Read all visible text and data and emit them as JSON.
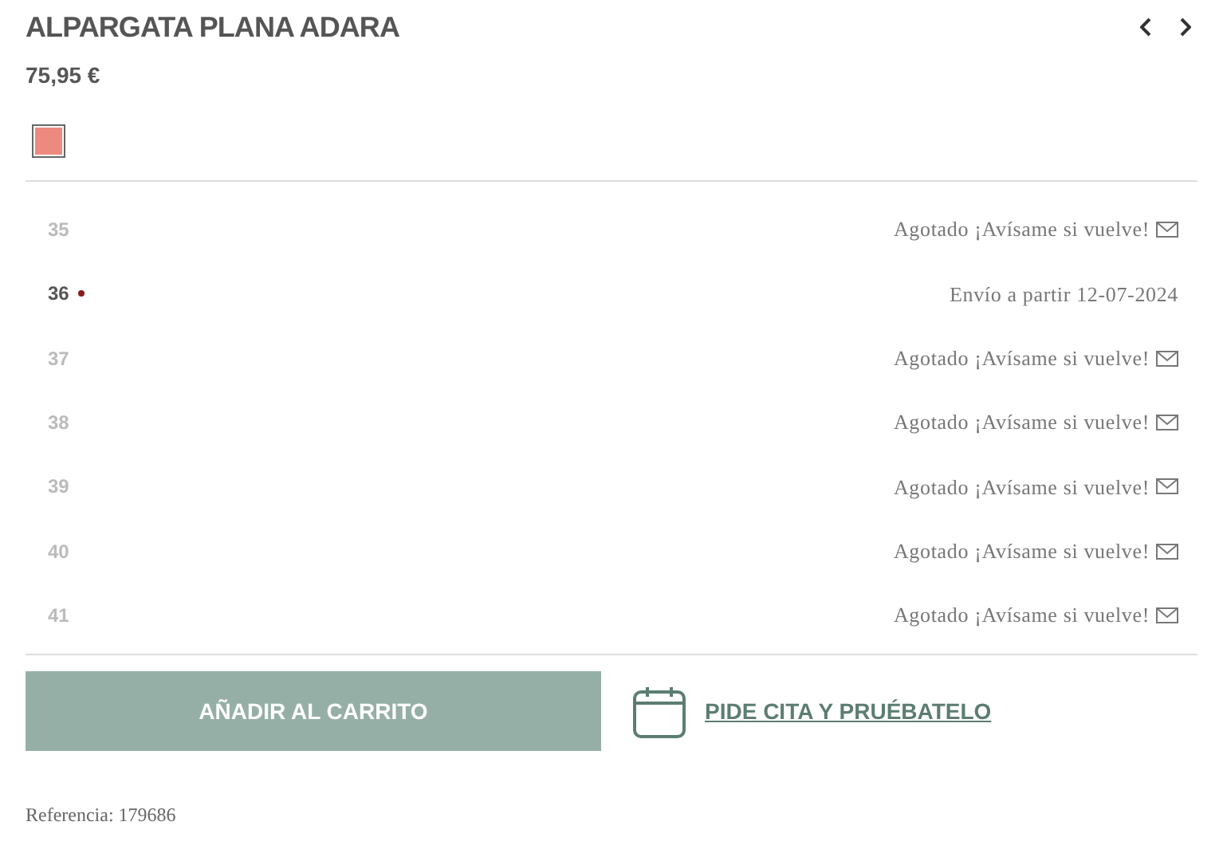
{
  "product": {
    "title": "ALPARGATA PLANA ADARA",
    "price": "75,95 €"
  },
  "swatches": [
    {
      "color": "#ec8a80",
      "selected": true
    }
  ],
  "sizes": [
    {
      "size": "35",
      "available": false,
      "status": "Agotado ¡Avísame si vuelve!"
    },
    {
      "size": "36",
      "available": true,
      "status": "Envío a partir 12-07-2024"
    },
    {
      "size": "37",
      "available": false,
      "status": "Agotado ¡Avísame si vuelve!"
    },
    {
      "size": "38",
      "available": false,
      "status": "Agotado ¡Avísame si vuelve!"
    },
    {
      "size": "39",
      "available": false,
      "status": "Agotado ¡Avísame si vuelve!"
    },
    {
      "size": "40",
      "available": false,
      "status": "Agotado ¡Avísame si vuelve!"
    },
    {
      "size": "41",
      "available": false,
      "status": "Agotado ¡Avísame si vuelve!"
    }
  ],
  "add_to_cart": "AÑADIR AL CARRITO",
  "appointment_link": "PIDE CITA Y PRUÉBATELO",
  "reference": "Referencia: 179686"
}
